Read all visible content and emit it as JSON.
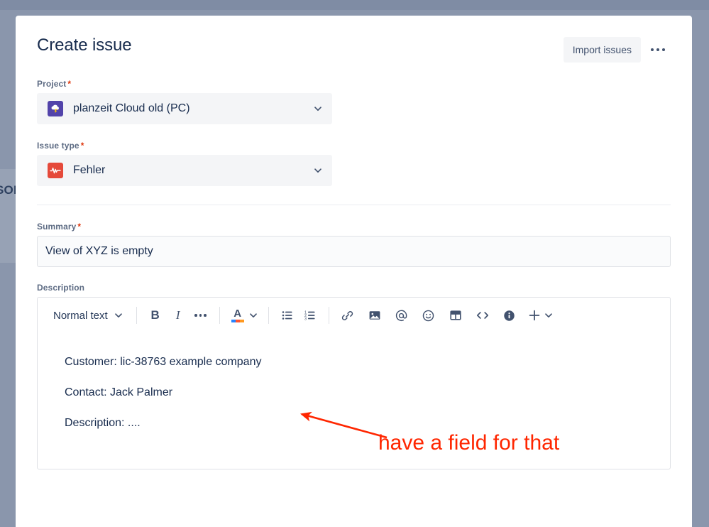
{
  "backdrop": {
    "partial_label": "SOF"
  },
  "modal": {
    "title": "Create issue",
    "header": {
      "import_label": "Import issues",
      "more_icon": "more-horizontal-icon"
    },
    "fields": {
      "project": {
        "label": "Project",
        "required_marker": "*",
        "value": "planzeit Cloud old (PC)",
        "icon": "project-avatar-cloud-lightning-icon",
        "icon_color": "#5243AA",
        "dropdown_icon": "chevron-down-icon"
      },
      "issue_type": {
        "label": "Issue type",
        "required_marker": "*",
        "value": "Fehler",
        "icon": "bug-icon",
        "icon_color": "#E5493A",
        "dropdown_icon": "chevron-down-icon"
      },
      "summary": {
        "label": "Summary",
        "required_marker": "*",
        "value": "View of XYZ is empty",
        "placeholder": ""
      },
      "description": {
        "label": "Description",
        "toolbar": {
          "text_style": "Normal text",
          "text_style_chevron": "chevron-down-icon",
          "bold": "B",
          "italic": "I",
          "more_formatting": "more-horizontal-icon",
          "text_color": "A",
          "text_color_chevron": "chevron-down-icon",
          "bullet_list": "bullet-list-icon",
          "numbered_list": "numbered-list-icon",
          "link": "link-icon",
          "image": "image-icon",
          "mention": "mention-at-icon",
          "emoji": "emoji-smiley-icon",
          "table": "table-icon",
          "code": "code-brackets-icon",
          "info_panel": "info-circle-icon",
          "insert_more": "plus-icon",
          "insert_more_chevron": "chevron-down-icon"
        },
        "body_lines": [
          "Customer: lic-38763 example company",
          "Contact: Jack Palmer",
          "Description: ...."
        ]
      }
    }
  },
  "annotation": {
    "text": "have a field for that",
    "color": "#FF2600",
    "arrow": "arrow-pointing-up-left"
  }
}
